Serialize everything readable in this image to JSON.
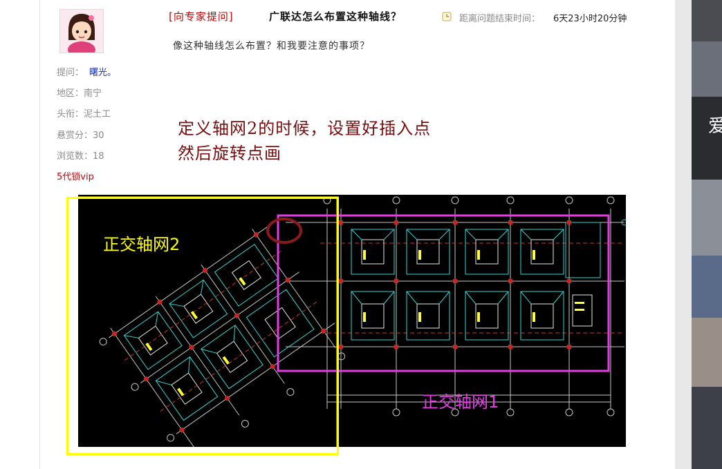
{
  "question": {
    "tag": "[向专家提问]",
    "title": "广联达怎么布置这种轴线？",
    "countdown_label": "距离问题结束时间：",
    "countdown_value": "6天23小时20分钟",
    "body": "像这种轴线怎么布置？和我要注意的事项？"
  },
  "asker": {
    "asked_by_label": "提问：",
    "asked_by_name": "曙光。",
    "region": "地区：南宁",
    "title": "头衔：泥土工",
    "reward": "悬赏分：30",
    "views": "浏览数：18",
    "vip": "5代锁vip"
  },
  "annotation": {
    "line1": "定义轴网2的时候，设置好插入点",
    "line2": "然后旋转点画"
  },
  "drawing": {
    "label_grid2": "正交轴网2",
    "label_grid1": "正交轴网1",
    "colors": {
      "background": "#000000",
      "grid2_box": "#ffff00",
      "grid1_box": "#e63ce6",
      "marker": "#8b1a1a",
      "lines": "#33d6d6",
      "walls": "#e8e8e8",
      "axes": "#c8c8c8",
      "text": "#ffff33",
      "dashed": "#cc3333"
    }
  },
  "right_panel": {
    "char": "爱"
  },
  "icons": {
    "avatar": "cartoon-girl-avatar",
    "clock": "clock-icon"
  }
}
